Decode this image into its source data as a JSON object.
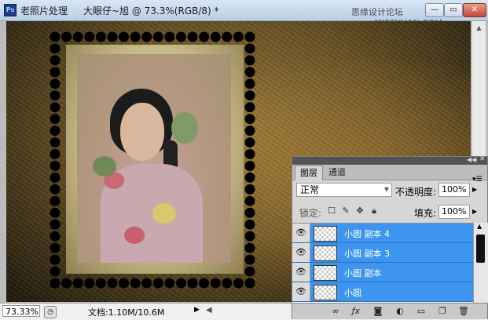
{
  "window": {
    "app_icon": "Ps",
    "app_title": "老照片处理",
    "doc_title": "大眼仔~旭 @ 73.3%(RGB/8) *",
    "watermark_text": "思缘设计论坛 www.MISSYUAN.COM",
    "buttons": {
      "minimize": "—",
      "maximize": "▭",
      "close": "✕"
    }
  },
  "status": {
    "zoom": "73.33%",
    "doc_info": "文档:1.10M/10.6M"
  },
  "layers_panel": {
    "tabs": [
      {
        "label": "图层",
        "active": true
      },
      {
        "label": "通道",
        "active": false
      }
    ],
    "blend_mode": "正常",
    "opacity_label": "不透明度:",
    "opacity_value": "100%",
    "lock_label": "锁定:",
    "fill_label": "填充:",
    "fill_value": "100%",
    "layers": [
      {
        "name": "小圆 副本 4",
        "visible": true,
        "selected": true
      },
      {
        "name": "小圆 副本 3",
        "visible": true,
        "selected": true
      },
      {
        "name": "小圆 副本",
        "visible": true,
        "selected": true
      },
      {
        "name": "小圆",
        "visible": true,
        "selected": true
      }
    ]
  },
  "colors": {
    "selection_blue": "#3d95f0",
    "panel_gray": "#d6d6d6",
    "titlebar_blue": "#c8daee"
  },
  "icons": {
    "layer_visibility": "eye-icon",
    "panel_bottom": [
      "link-icon",
      "fx-icon",
      "mask-icon",
      "adjustment-icon",
      "group-folder-icon",
      "new-layer-icon",
      "trash-icon"
    ]
  }
}
